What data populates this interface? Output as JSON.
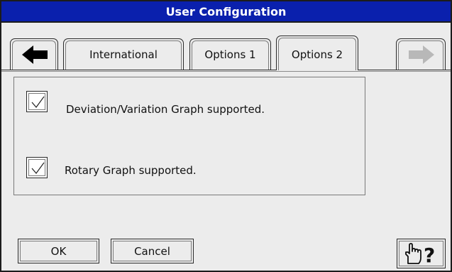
{
  "window": {
    "title": "User Configuration"
  },
  "tabs": [
    {
      "label": "International",
      "active": false
    },
    {
      "label": "Options 1",
      "active": false
    },
    {
      "label": "Options 2",
      "active": true
    }
  ],
  "nav": {
    "prev_icon": "left-arrow-icon",
    "next_icon": "right-arrow-icon",
    "next_enabled": false
  },
  "options": [
    {
      "label": "Deviation/Variation Graph supported.",
      "checked": true
    },
    {
      "label": "Rotary Graph supported.",
      "checked": true
    }
  ],
  "buttons": {
    "ok": "OK",
    "cancel": "Cancel",
    "help_icon": "pointing-hand-question-icon"
  },
  "colors": {
    "titlebar": "#0a20ad",
    "title_text": "#ffffff",
    "background": "#ececec"
  }
}
